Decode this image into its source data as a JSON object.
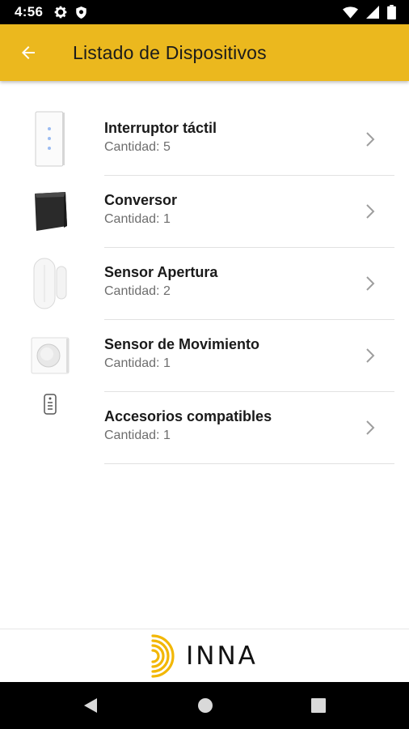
{
  "status_bar": {
    "time": "4:56",
    "left_icons": [
      "settings-icon",
      "shield-icon"
    ],
    "right_icons": [
      "wifi-icon",
      "signal-icon",
      "battery-icon"
    ]
  },
  "app_bar": {
    "back_icon": "arrow-back-icon",
    "title": "Listado de Dispositivos",
    "background": "#ebb81e"
  },
  "devices": [
    {
      "name": "Interruptor táctil",
      "quantity": "Cantidad: 5",
      "icon": "touch-switch"
    },
    {
      "name": "Conversor",
      "quantity": "Cantidad: 1",
      "icon": "converter"
    },
    {
      "name": "Sensor Apertura",
      "quantity": "Cantidad: 2",
      "icon": "door-sensor"
    },
    {
      "name": "Sensor de Movimiento",
      "quantity": "Cantidad: 1",
      "icon": "motion-sensor"
    },
    {
      "name": "Accesorios compatibles",
      "quantity": "Cantidad: 1",
      "icon": "remote-accessory"
    }
  ],
  "footer": {
    "brand": "INNA",
    "logo_icon": "dinna-d-logo",
    "logo_color": "#f2b705"
  },
  "nav_bar": {
    "buttons": [
      "back-triangle-icon",
      "home-circle-icon",
      "recents-square-icon"
    ]
  }
}
